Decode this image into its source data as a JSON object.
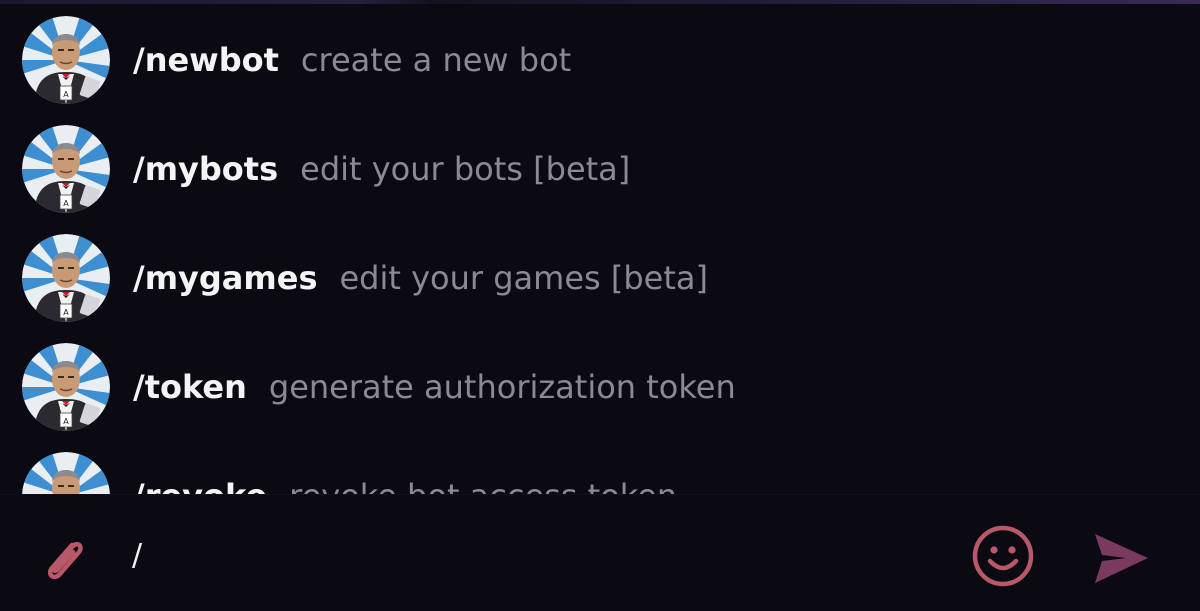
{
  "colors": {
    "background": "#0b0a12",
    "command_name": "#f4f4f6",
    "command_description": "#8b8a93",
    "icon_accent": "#b85868",
    "send_icon": "#7a3a60"
  },
  "commands": [
    {
      "name": "/newbot",
      "description": "create a new bot",
      "avatar": "botfather-avatar"
    },
    {
      "name": "/mybots",
      "description": "edit your bots [beta]",
      "avatar": "botfather-avatar"
    },
    {
      "name": "/mygames",
      "description": "edit your games [beta]",
      "avatar": "botfather-avatar"
    },
    {
      "name": "/token",
      "description": "generate authorization token",
      "avatar": "botfather-avatar"
    },
    {
      "name": "/revoke",
      "description": "revoke bot access token",
      "avatar": "botfather-avatar"
    }
  ],
  "composer": {
    "text": "/",
    "attach_icon": "paperclip-icon",
    "emoji_icon": "smiley-icon",
    "send_icon": "send-arrow-icon"
  }
}
